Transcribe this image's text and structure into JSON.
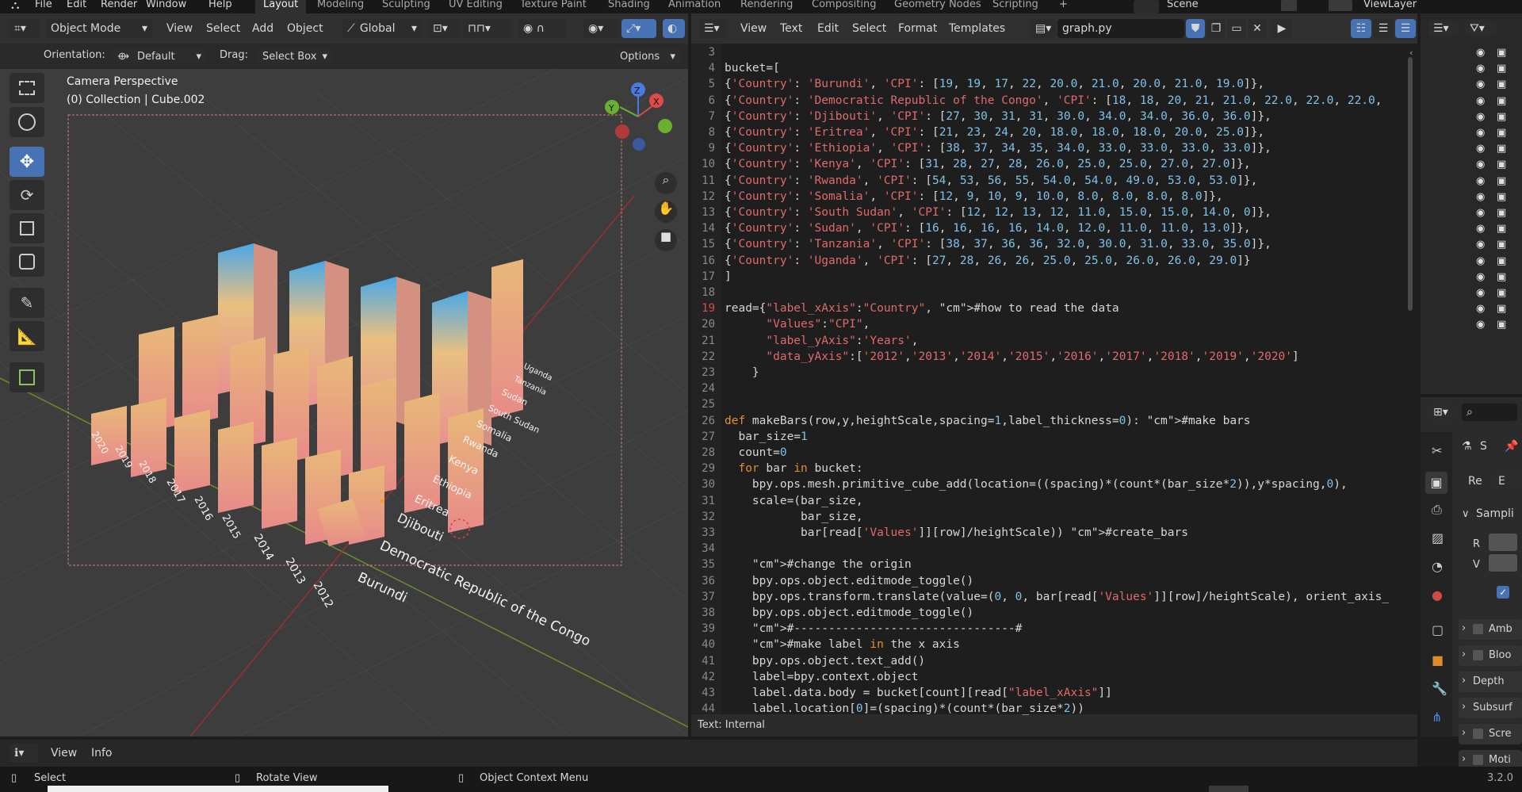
{
  "topbar": {
    "menus": [
      "File",
      "Edit",
      "Render",
      "Window",
      "Help"
    ],
    "workspaces": [
      "Layout",
      "Modeling",
      "Sculpting",
      "UV Editing",
      "Texture Paint",
      "Shading",
      "Animation",
      "Rendering",
      "Compositing",
      "Geometry Nodes",
      "Scripting"
    ],
    "add_tab": "+",
    "scene": "Scene",
    "view_layer": "ViewLayer"
  },
  "viewport": {
    "mode": "Object Mode",
    "menus": [
      "View",
      "Select",
      "Add",
      "Object"
    ],
    "transform": "Global",
    "orientation_label": "Orientation:",
    "orientation_value": "Default",
    "drag_label": "Drag:",
    "drag_value": "Select Box",
    "options": "Options",
    "overlay_title": "Camera Perspective",
    "overlay_sub": "(0) Collection | Cube.002",
    "gizmo": {
      "x": "X",
      "y": "Y",
      "z": "Z"
    }
  },
  "text_editor": {
    "menus": [
      "View",
      "Text",
      "Edit",
      "Select",
      "Format",
      "Templates"
    ],
    "filename": "graph.py",
    "footer": "Text: Internal",
    "lines": [
      {
        "n": "3",
        "t": ""
      },
      {
        "n": "4",
        "t": "bucket=["
      },
      {
        "n": "5",
        "t": "{'Country': 'Burundi', 'CPI': [19, 19, 17, 22, 20.0, 21.0, 20.0, 21.0, 19.0]},"
      },
      {
        "n": "6",
        "t": "{'Country': 'Democratic Republic of the Congo', 'CPI': [18, 18, 20, 21, 21.0, 22.0, 22.0, 22.0,"
      },
      {
        "n": "7",
        "t": "{'Country': 'Djibouti', 'CPI': [27, 30, 31, 31, 30.0, 34.0, 34.0, 36.0, 36.0]},"
      },
      {
        "n": "8",
        "t": "{'Country': 'Eritrea', 'CPI': [21, 23, 24, 20, 18.0, 18.0, 18.0, 20.0, 25.0]},"
      },
      {
        "n": "9",
        "t": "{'Country': 'Ethiopia', 'CPI': [38, 37, 34, 35, 34.0, 33.0, 33.0, 33.0, 33.0]},"
      },
      {
        "n": "10",
        "t": "{'Country': 'Kenya', 'CPI': [31, 28, 27, 28, 26.0, 25.0, 25.0, 27.0, 27.0]},"
      },
      {
        "n": "11",
        "t": "{'Country': 'Rwanda', 'CPI': [54, 53, 56, 55, 54.0, 54.0, 49.0, 53.0, 53.0]},"
      },
      {
        "n": "12",
        "t": "{'Country': 'Somalia', 'CPI': [12, 9, 10, 9, 10.0, 8.0, 8.0, 8.0, 8.0]},"
      },
      {
        "n": "13",
        "t": "{'Country': 'South Sudan', 'CPI': [12, 12, 13, 12, 11.0, 15.0, 15.0, 14.0, 0]},"
      },
      {
        "n": "14",
        "t": "{'Country': 'Sudan', 'CPI': [16, 16, 16, 16, 14.0, 12.0, 11.0, 11.0, 13.0]},"
      },
      {
        "n": "15",
        "t": "{'Country': 'Tanzania', 'CPI': [38, 37, 36, 36, 32.0, 30.0, 31.0, 33.0, 35.0]},"
      },
      {
        "n": "16",
        "t": "{'Country': 'Uganda', 'CPI': [27, 28, 26, 26, 25.0, 25.0, 26.0, 26.0, 29.0]}"
      },
      {
        "n": "17",
        "t": "]"
      },
      {
        "n": "18",
        "t": ""
      },
      {
        "n": "19",
        "t": "read={\"label_xAxis\":\"Country\", #how to read the data"
      },
      {
        "n": "20",
        "t": "      \"Values\":\"CPI\","
      },
      {
        "n": "21",
        "t": "      \"label_yAxis\":'Years',"
      },
      {
        "n": "22",
        "t": "      \"data_yAxis\":['2012','2013','2014','2015','2016','2017','2018','2019','2020']"
      },
      {
        "n": "23",
        "t": "    }"
      },
      {
        "n": "24",
        "t": ""
      },
      {
        "n": "25",
        "t": ""
      },
      {
        "n": "26",
        "t": "def makeBars(row,y,heightScale,spacing=1,label_thickness=0): #make bars"
      },
      {
        "n": "27",
        "t": "  bar_size=1"
      },
      {
        "n": "28",
        "t": "  count=0"
      },
      {
        "n": "29",
        "t": "  for bar in bucket:"
      },
      {
        "n": "30",
        "t": "    bpy.ops.mesh.primitive_cube_add(location=((spacing)*(count*(bar_size*2)),y*spacing,0),"
      },
      {
        "n": "31",
        "t": "    scale=(bar_size,"
      },
      {
        "n": "32",
        "t": "           bar_size,"
      },
      {
        "n": "33",
        "t": "           bar[read['Values']][row]/heightScale)) #create_bars"
      },
      {
        "n": "34",
        "t": ""
      },
      {
        "n": "35",
        "t": "    #change the origin"
      },
      {
        "n": "36",
        "t": "    bpy.ops.object.editmode_toggle()"
      },
      {
        "n": "37",
        "t": "    bpy.ops.transform.translate(value=(0, 0, bar[read['Values']][row]/heightScale), orient_axis_"
      },
      {
        "n": "38",
        "t": "    bpy.ops.object.editmode_toggle()"
      },
      {
        "n": "39",
        "t": "    #--------------------------------#"
      },
      {
        "n": "40",
        "t": "    #make label in the x axis"
      },
      {
        "n": "41",
        "t": "    bpy.ops.object.text_add()"
      },
      {
        "n": "42",
        "t": "    label=bpy.context.object"
      },
      {
        "n": "43",
        "t": "    label.data.body = bucket[count][read[\"label_xAxis\"]]"
      },
      {
        "n": "44",
        "t": "    label.location[0]=(spacing)*(count*(bar_size*2))"
      }
    ]
  },
  "scene_labels": {
    "countries": [
      "Burundi",
      "Democratic Republic of the Congo",
      "Djibouti",
      "Eritrea",
      "Ethiopia",
      "Kenya",
      "Rwanda",
      "Somalia",
      "South Sudan",
      "Sudan",
      "Tanzania",
      "Uganda"
    ],
    "years": [
      "2012",
      "2013",
      "2014",
      "2015",
      "2016",
      "2017",
      "2018",
      "2019",
      "2020"
    ]
  },
  "properties": {
    "tab_s": "S",
    "re_label": "Re",
    "e_label": "E",
    "section": "Sampli",
    "r_label": "R",
    "v_label": "V",
    "rows": [
      "Amb",
      "Bloo",
      "Depth",
      "Subsurf",
      "Scre",
      "Moti"
    ]
  },
  "bottom": {
    "menus": [
      "View",
      "Info"
    ]
  },
  "status": {
    "select": "Select",
    "rotate": "Rotate View",
    "context": "Object Context Menu",
    "version": "3.2.0"
  }
}
